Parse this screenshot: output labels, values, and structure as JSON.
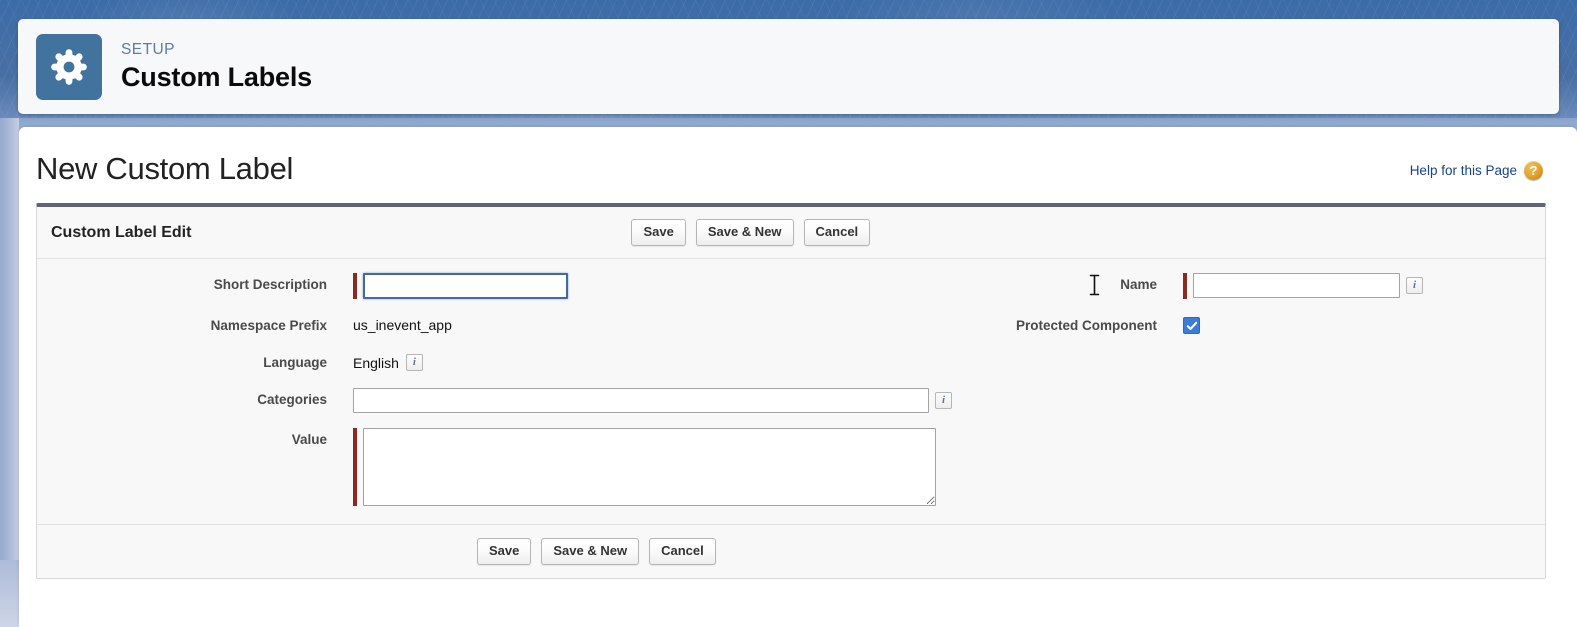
{
  "setup_header": {
    "eyebrow": "SETUP",
    "title": "Custom Labels",
    "icon": "gear-icon"
  },
  "page": {
    "title": "New Custom Label",
    "help_link": "Help for this Page",
    "help_icon": "question-mark-icon"
  },
  "panel": {
    "title": "Custom Label Edit",
    "buttons": {
      "save": "Save",
      "save_and_new": "Save & New",
      "cancel": "Cancel"
    }
  },
  "fields": {
    "short_description": {
      "label": "Short Description",
      "value": "",
      "required": true,
      "focused": true
    },
    "namespace_prefix": {
      "label": "Namespace Prefix",
      "value": "us_inevent_app"
    },
    "language": {
      "label": "Language",
      "value": "English",
      "info_icon": "info-icon"
    },
    "categories": {
      "label": "Categories",
      "value": "",
      "info_icon": "info-icon"
    },
    "value": {
      "label": "Value",
      "value": "",
      "required": true
    },
    "name": {
      "label": "Name",
      "value": "",
      "required": true,
      "info_icon": "info-icon"
    },
    "protected_component": {
      "label": "Protected Component",
      "checked": true
    }
  },
  "colors": {
    "setup_icon_bg": "#41739e",
    "required_bar": "#8c2a20",
    "focus_border": "#436a9c",
    "checkbox": "#3b7cd4",
    "help_icon": "#dfa12c",
    "panel_top_border": "#5f6575",
    "link": "#15428b"
  }
}
